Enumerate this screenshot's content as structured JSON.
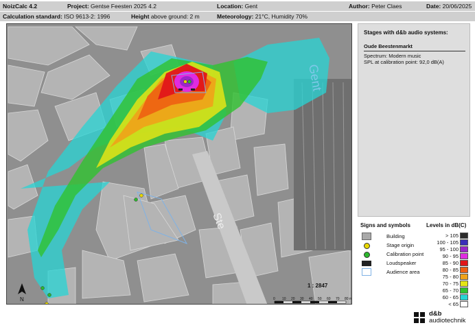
{
  "header": {
    "app": "NoizCalc 4.2",
    "project_label": "Project:",
    "project": "Gentse Feesten 2025 4.2",
    "location_label": "Location:",
    "location": "Gent",
    "author_label": "Author:",
    "author": "Peter Claes",
    "date_label": "Date:",
    "date": "20/06/2025",
    "calc_label": "Calculation standard:",
    "calc": "ISO 9613-2: 1996",
    "height_label": "Height",
    "height": "above ground: 2 m",
    "met_label": "Meteorology:",
    "met": "21°C, Humidity 70%"
  },
  "map": {
    "street_label": "Gent",
    "street_label_2": "Ste",
    "scale": "1 : 2847",
    "north": "N",
    "scale_ticks": [
      "0",
      "10",
      "20",
      "30",
      "40",
      "50",
      "60",
      "70",
      "80 m"
    ]
  },
  "stages": {
    "title": "Stages with d&b audio systems:",
    "name": "Oude Beestenmarkt",
    "spectrum": "Spectrum:  Modern music",
    "spl": "SPL at calibration point:  92,0 dB(A)"
  },
  "symbols": {
    "title": "Signs and symbols",
    "items": [
      {
        "label": "Building",
        "icon": "building-swatch",
        "color": "#a9a9a9"
      },
      {
        "label": "Stage origin",
        "icon": "stage-origin-dot",
        "color": "#e8d800"
      },
      {
        "label": "Calibration point",
        "icon": "calibration-dot",
        "color": "#2db82d"
      },
      {
        "label": "Loudspeaker",
        "icon": "loudspeaker-bar",
        "color": "#222222"
      },
      {
        "label": "Audience area",
        "icon": "audience-area-box",
        "color": "#7fb2e6"
      }
    ]
  },
  "levels": {
    "title": "Levels in dB(C)",
    "items": [
      {
        "label": "> 105",
        "color": "#2b2b2b"
      },
      {
        "label": "100 - 105",
        "color": "#3a2fb8"
      },
      {
        "label": "95 - 100",
        "color": "#9b27c9"
      },
      {
        "label": "90 - 95",
        "color": "#e02be0"
      },
      {
        "label": "85 - 90",
        "color": "#e0161a"
      },
      {
        "label": "80 - 85",
        "color": "#ee5f12"
      },
      {
        "label": "75 - 80",
        "color": "#f0a21a"
      },
      {
        "label": "70 - 75",
        "color": "#e4e415"
      },
      {
        "label": "65 - 70",
        "color": "#2fc22f"
      },
      {
        "label": "60 - 65",
        "color": "#27d4d4"
      },
      {
        "label": "< 65",
        "color": "#ffffff"
      }
    ]
  },
  "logo": {
    "line1": "d&b",
    "line2": "audiotechnik"
  }
}
